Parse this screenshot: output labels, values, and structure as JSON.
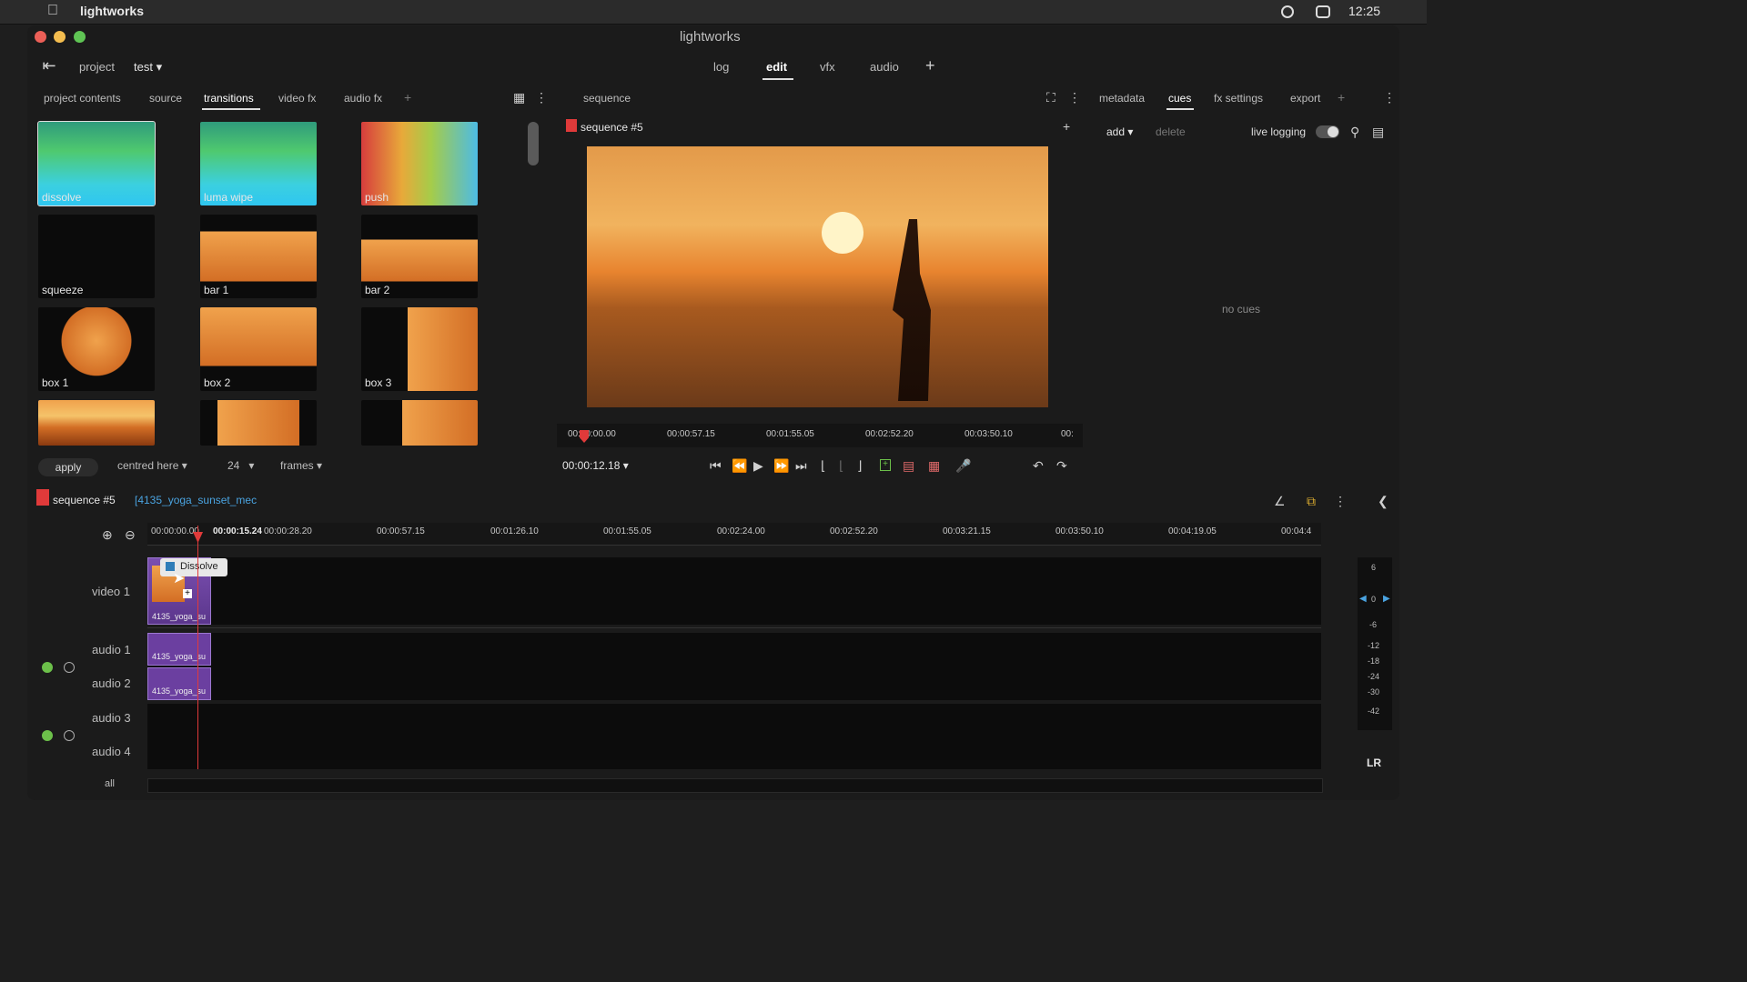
{
  "menubar": {
    "app": "lightworks",
    "clock": "12:25"
  },
  "window": {
    "title": "lightworks"
  },
  "nav": {
    "project_label": "project",
    "project_name": "test"
  },
  "modes": {
    "log": "log",
    "edit": "edit",
    "vfx": "vfx",
    "audio": "audio"
  },
  "left_tabs": {
    "project_contents": "project contents",
    "source": "source",
    "transitions": "transitions",
    "video_fx": "video fx",
    "audio_fx": "audio fx"
  },
  "transitions": [
    {
      "label": "dissolve",
      "style": "grad"
    },
    {
      "label": "luma wipe",
      "style": "grad"
    },
    {
      "label": "push",
      "style": "grad2"
    },
    {
      "label": "squeeze",
      "style": "black"
    },
    {
      "label": "bar 1",
      "style": "scene"
    },
    {
      "label": "bar 2",
      "style": "scene"
    },
    {
      "label": "box 1",
      "style": "scene"
    },
    {
      "label": "box 2",
      "style": "scene"
    },
    {
      "label": "box 3",
      "style": "scene"
    },
    {
      "label": "",
      "style": "scene"
    },
    {
      "label": "",
      "style": "scene"
    },
    {
      "label": "",
      "style": "scene"
    }
  ],
  "apply_bar": {
    "apply": "apply",
    "position": "centred here",
    "count": "24",
    "unit": "frames"
  },
  "viewer": {
    "title": "sequence",
    "sequence_name": "sequence #5",
    "timecode": "00:00:12.18",
    "ruler": [
      "00:00:00.00",
      "00:00:57.15",
      "00:01:55.05",
      "00:02:52.20",
      "00:03:50.10",
      "00:"
    ]
  },
  "right_tabs": {
    "metadata": "metadata",
    "cues": "cues",
    "fx_settings": "fx settings",
    "export": "export"
  },
  "cues": {
    "add": "add",
    "delete": "delete",
    "live_logging": "live logging",
    "empty": "no cues"
  },
  "timeline": {
    "sequence_name": "sequence #5",
    "clip_name": "[4135_yoga_sunset_mec",
    "ruler": [
      "00:00:00.00",
      "00:00:15.24",
      "00:00:28.20",
      "00:00:57.15",
      "00:01:26.10",
      "00:01:55.05",
      "00:02:24.00",
      "00:02:52.20",
      "00:03:21.15",
      "00:03:50.10",
      "00:04:19.05",
      "00:04:4"
    ],
    "tracks": {
      "video1": "video 1",
      "audio1": "audio 1",
      "audio2": "audio 2",
      "audio3": "audio 3",
      "audio4": "audio 4",
      "all": "all"
    },
    "clip_labels": [
      "4135_yoga_su",
      "4135_yoga_su",
      "4135_yoga_su"
    ],
    "tooltip": "Dissolve",
    "meter": [
      "6",
      "0",
      "-6",
      "-12",
      "-18",
      "-24",
      "-30",
      "-42"
    ],
    "meter_lr": "LR"
  },
  "colors": {
    "accent": "#2f7db8",
    "playhead": "#e03a3a",
    "clip": "#6b3fa0"
  }
}
